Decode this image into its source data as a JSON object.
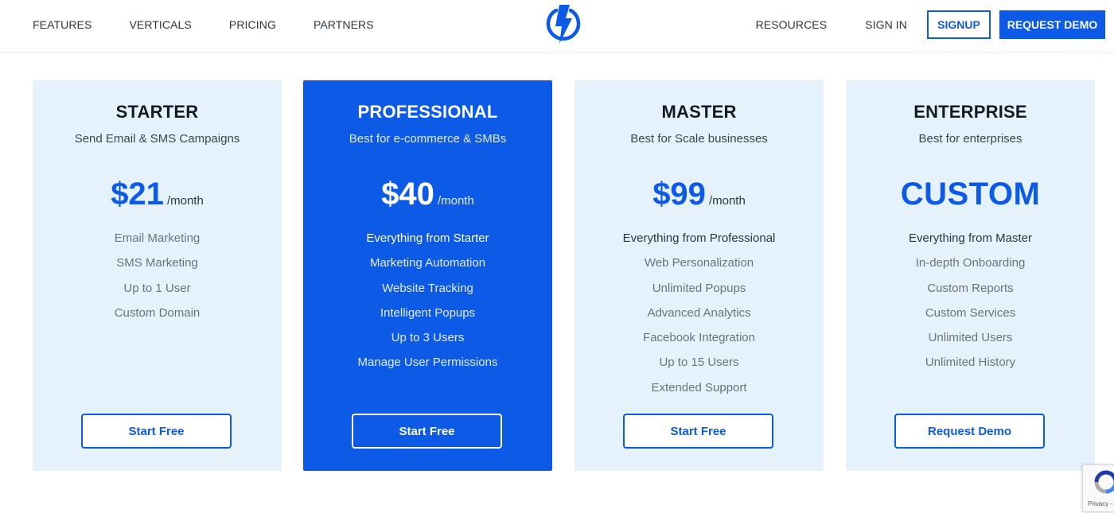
{
  "header": {
    "nav_left": [
      "FEATURES",
      "VERTICALS",
      "PRICING",
      "PARTNERS"
    ],
    "logo_icon": "lightning-bolt-icon",
    "nav_right": {
      "resources": "RESOURCES",
      "signin": "SIGN IN",
      "signup": "SIGNUP",
      "request_demo": "REQUEST DEMO"
    }
  },
  "colors": {
    "brand": "#0c5ae6",
    "card_bg": "#e5f2fc",
    "text_dark": "#141a24",
    "text_muted": "#6a7280"
  },
  "plans": [
    {
      "name": "STARTER",
      "subtitle": "Send Email & SMS Campaigns",
      "price": "$21",
      "period": "/month",
      "features": [
        "Email Marketing",
        "SMS Marketing",
        "Up to 1 User",
        "Custom Domain"
      ],
      "button": "Start Free"
    },
    {
      "name": "PROFESSIONAL",
      "subtitle": "Best for e-commerce & SMBs",
      "price": "$40",
      "period": "/month",
      "features": [
        "Everything from Starter",
        "Marketing Automation",
        "Website Tracking",
        "Intelligent Popups",
        "Up to 3 Users",
        "Manage User Permissions"
      ],
      "button": "Start Free"
    },
    {
      "name": "MASTER",
      "subtitle": "Best for Scale businesses",
      "price": "$99",
      "period": "/month",
      "features": [
        "Everything from Professional",
        "Web Personalization",
        "Unlimited Popups",
        "Advanced Analytics",
        "Facebook Integration",
        "Up to 15 Users",
        "Extended Support"
      ],
      "button": "Start Free"
    },
    {
      "name": "ENTERPRISE",
      "subtitle": "Best for enterprises",
      "price": "CUSTOM",
      "features": [
        "Everything from Master",
        "In-depth Onboarding",
        "Custom Reports",
        "Custom Services",
        "Unlimited Users",
        "Unlimited History"
      ],
      "button": "Request Demo"
    }
  ],
  "recaptcha": {
    "icon": "recaptcha-icon",
    "label": "Privacy -"
  }
}
